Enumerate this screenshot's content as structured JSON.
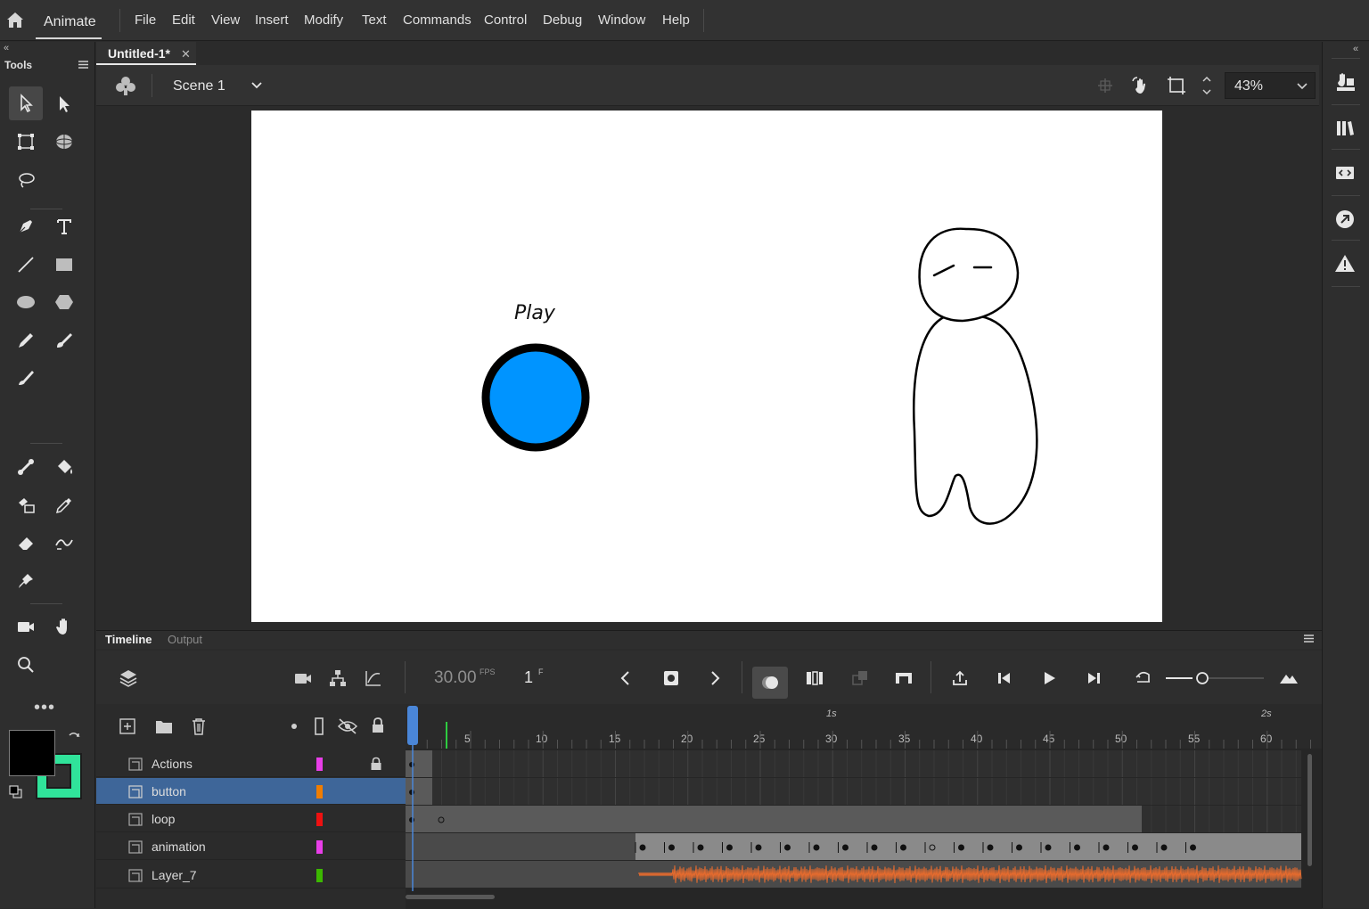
{
  "app": {
    "name": "Animate"
  },
  "menu": [
    "File",
    "Edit",
    "View",
    "Insert",
    "Modify",
    "Text",
    "Commands",
    "Control",
    "Debug",
    "Window",
    "Help"
  ],
  "tools_panel": {
    "title": "Tools",
    "fill_color": "#000000",
    "stroke_color": "#30e39a"
  },
  "document": {
    "tab_title": "Untitled-1*",
    "scene": "Scene 1",
    "zoom": "43%"
  },
  "stage": {
    "button_label": "Play",
    "background": "#ffffff",
    "button_fill": "#0094ff"
  },
  "timeline": {
    "tabs": [
      "Timeline",
      "Output"
    ],
    "fps": "30.00",
    "fps_unit": "FPS",
    "current_frame": "1",
    "frame_unit": "F",
    "ruler": {
      "frame_numbers": [
        "5",
        "10",
        "15",
        "20",
        "25",
        "30",
        "35",
        "40",
        "45",
        "50",
        "55",
        "60"
      ],
      "seconds": [
        "1s",
        "2s"
      ]
    },
    "layers": [
      {
        "name": "Actions",
        "color": "#e83ee8",
        "locked": true,
        "selected": false
      },
      {
        "name": "button",
        "color": "#f07d00",
        "locked": false,
        "selected": true
      },
      {
        "name": "loop",
        "color": "#ee1111",
        "locked": false,
        "selected": false
      },
      {
        "name": "animation",
        "color": "#e83ee8",
        "locked": false,
        "selected": false
      },
      {
        "name": "Layer_7",
        "color": "#3cb800",
        "locked": false,
        "selected": false
      }
    ]
  }
}
